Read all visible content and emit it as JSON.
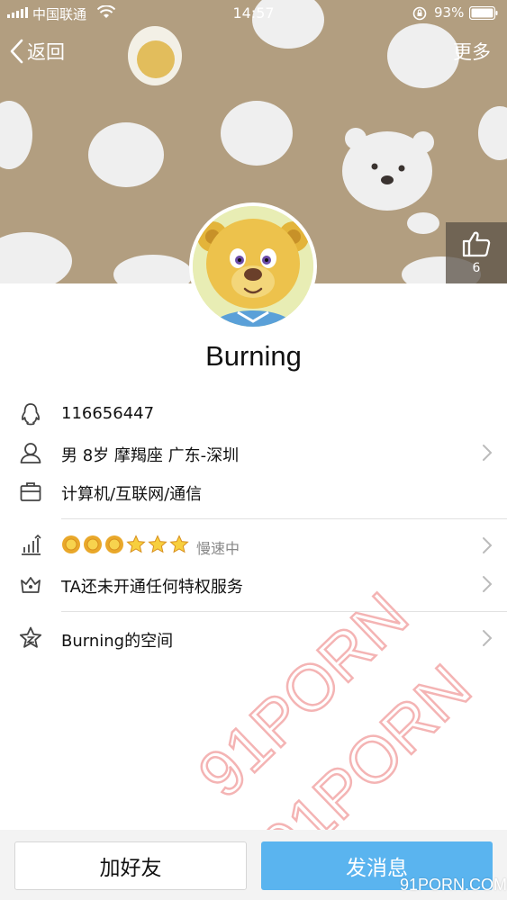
{
  "status_bar": {
    "carrier": "中国联通",
    "time": "14:57",
    "battery_percent": "93%"
  },
  "nav": {
    "back_label": "返回",
    "more_label": "更多"
  },
  "like": {
    "count": "6",
    "icon": "thumbs-up-icon"
  },
  "profile": {
    "nickname": "Burning",
    "qq_number": "116656447",
    "basic_info": "男 8岁 摩羯座 广东-深圳",
    "occupation": "计算机/互联网/通信",
    "level_status": "慢速中",
    "level_icons": [
      "sun",
      "sun",
      "sun",
      "star",
      "star",
      "star"
    ],
    "privilege": "TA还未开通任何特权服务",
    "space": "Burning的空间"
  },
  "actions": {
    "add_friend": "加好友",
    "send_message": "发消息"
  },
  "watermark": {
    "text": "91PORN",
    "site": "91PORN.COM"
  },
  "colors": {
    "cover_bg": "#b29e80",
    "accent_blue": "#5ab4ef",
    "watermark_red": "#f4b4b4"
  }
}
